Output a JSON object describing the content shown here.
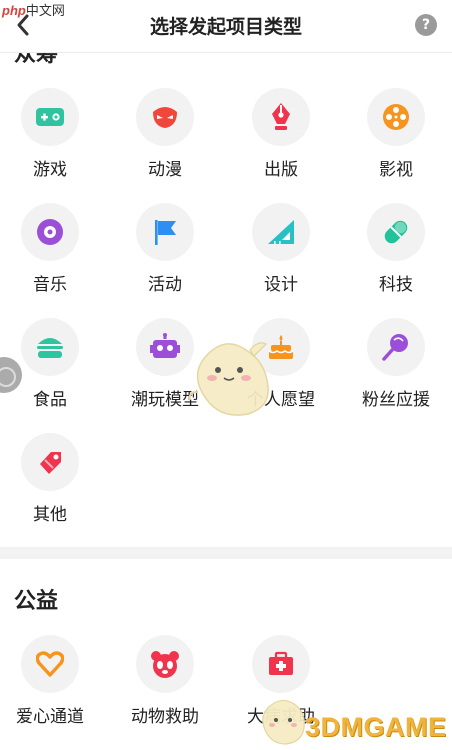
{
  "watermark": {
    "brand_php": "php",
    "brand_text": "中文网",
    "site_text": "3DMGAME"
  },
  "header": {
    "title": "选择发起项目类型",
    "help_label": "?"
  },
  "sections": {
    "creative": {
      "title": "众筹",
      "items": [
        {
          "label": "游戏",
          "icon": "gamepad-icon",
          "color": "#2ec4a0"
        },
        {
          "label": "动漫",
          "icon": "mask-icon",
          "color": "#f0463c"
        },
        {
          "label": "出版",
          "icon": "pen-nib-icon",
          "color": "#f0344d"
        },
        {
          "label": "影视",
          "icon": "film-reel-icon",
          "color": "#f7941d"
        },
        {
          "label": "音乐",
          "icon": "vinyl-record-icon",
          "color": "#9b4fd9"
        },
        {
          "label": "活动",
          "icon": "flag-icon",
          "color": "#2f8ef2"
        },
        {
          "label": "设计",
          "icon": "triangle-ruler-icon",
          "color": "#27c0c4"
        },
        {
          "label": "科技",
          "icon": "capsule-icon",
          "color": "#22c39a"
        },
        {
          "label": "食品",
          "icon": "burger-icon",
          "color": "#2ec4a0"
        },
        {
          "label": "潮玩模型",
          "icon": "robot-icon",
          "color": "#9b4fd9"
        },
        {
          "label": "个人愿望",
          "icon": "birthday-cake-icon",
          "color": "#f7941d"
        },
        {
          "label": "粉丝应援",
          "icon": "lollipop-icon",
          "color": "#9b4fd9"
        },
        {
          "label": "其他",
          "icon": "tag-icon",
          "color": "#f0344d"
        }
      ]
    },
    "charity": {
      "title": "公益",
      "items": [
        {
          "label": "爱心通道",
          "icon": "heart-icon",
          "color": "#f7941d"
        },
        {
          "label": "动物救助",
          "icon": "panda-icon",
          "color": "#f0344d"
        },
        {
          "label": "大病求助",
          "icon": "first-aid-kit-icon",
          "color": "#f0344d"
        }
      ]
    }
  }
}
